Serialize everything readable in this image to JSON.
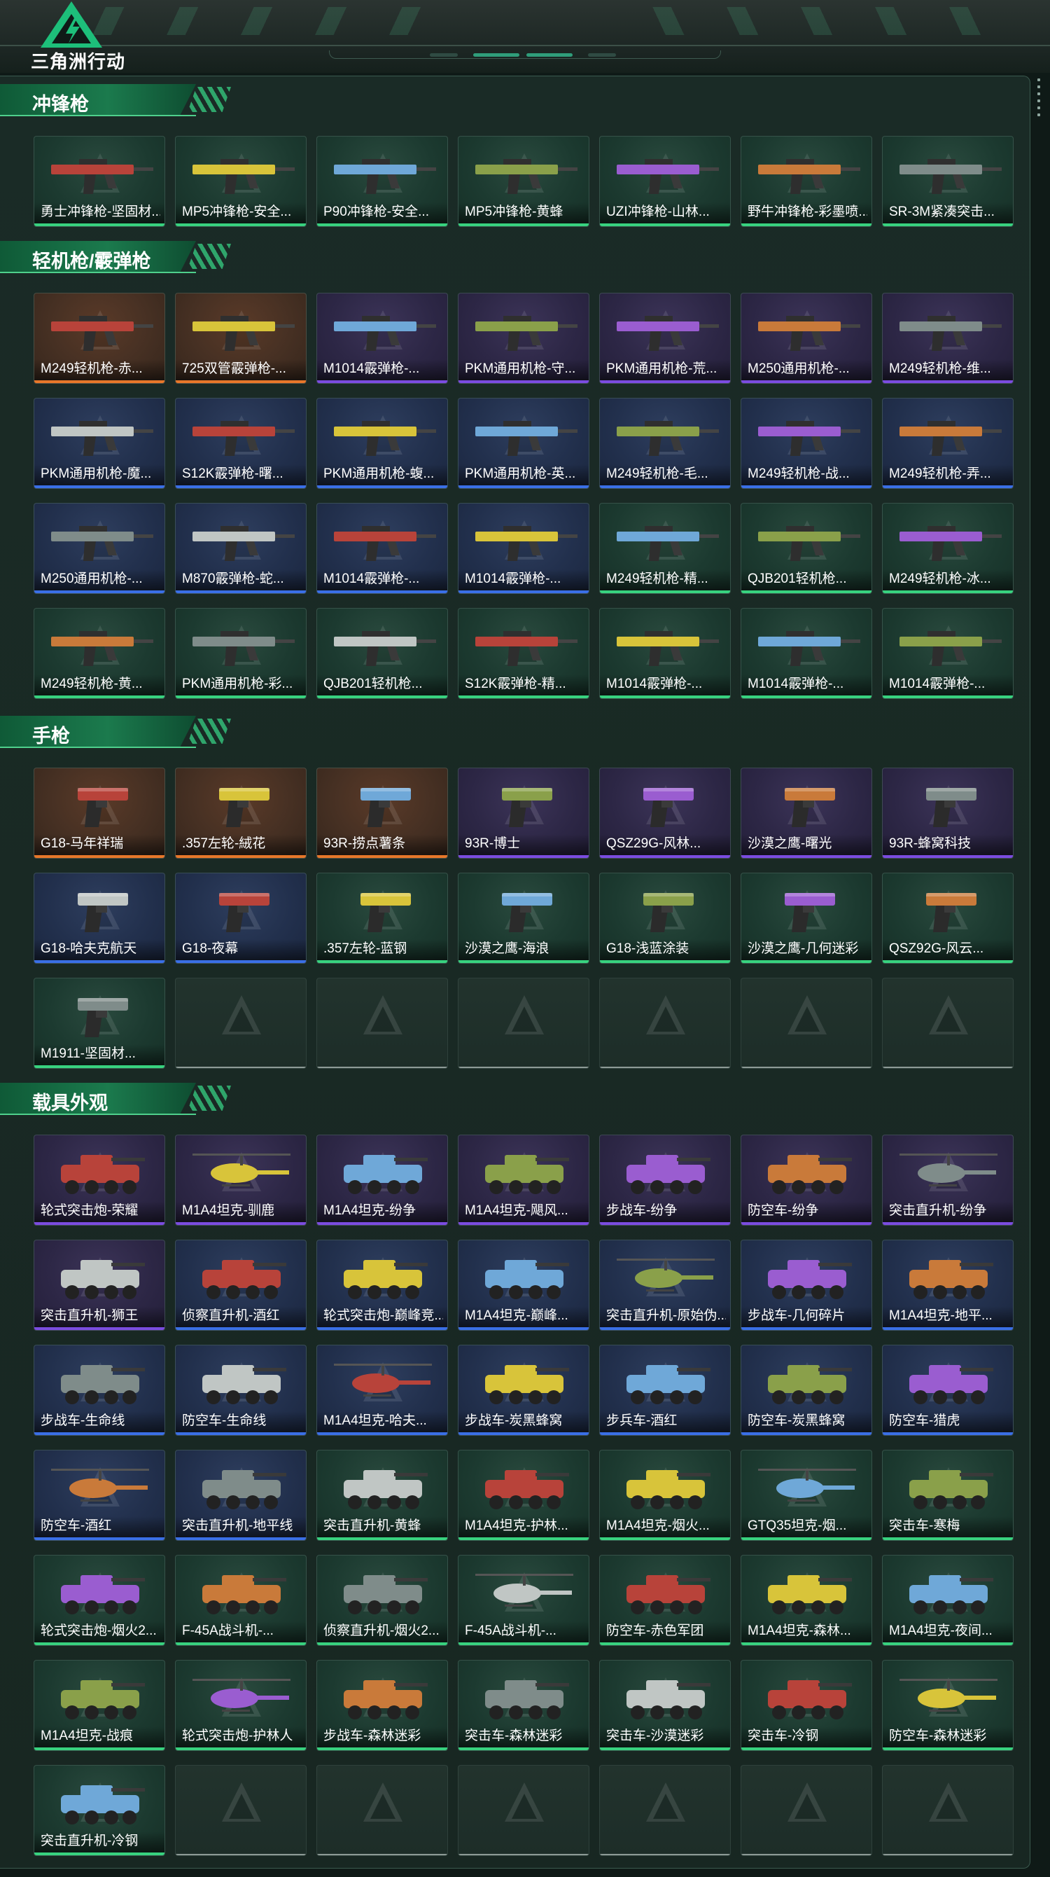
{
  "header": {
    "logo_text": "三角洲行动"
  },
  "colors": {
    "green": "#38d27f",
    "purple": "#7b4ce0",
    "blue": "#3a6fe6",
    "orange": "#e7772a"
  },
  "sections": [
    {
      "title": "冲锋枪",
      "icon": "gun-icon",
      "items": [
        {
          "name": "勇士冲锋枪-坚固材...",
          "rarity": "green"
        },
        {
          "name": "MP5冲锋枪-安全...",
          "rarity": "green"
        },
        {
          "name": "P90冲锋枪-安全...",
          "rarity": "green"
        },
        {
          "name": "MP5冲锋枪-黄蜂",
          "rarity": "green"
        },
        {
          "name": "UZI冲锋枪-山林...",
          "rarity": "green"
        },
        {
          "name": "野牛冲锋枪-彩墨喷...",
          "rarity": "green"
        },
        {
          "name": "SR-3M紧凑突击...",
          "rarity": "green"
        }
      ]
    },
    {
      "title": "轻机枪/霰弹枪",
      "icon": "gun-icon",
      "items": [
        {
          "name": "M249轻机枪-赤...",
          "rarity": "orange"
        },
        {
          "name": "725双管霰弹枪-...",
          "rarity": "orange"
        },
        {
          "name": "M1014霰弹枪-...",
          "rarity": "purple"
        },
        {
          "name": "PKM通用机枪-守...",
          "rarity": "purple"
        },
        {
          "name": "PKM通用机枪-荒...",
          "rarity": "purple"
        },
        {
          "name": "M250通用机枪-...",
          "rarity": "purple"
        },
        {
          "name": "M249轻机枪-维...",
          "rarity": "purple"
        },
        {
          "name": "PKM通用机枪-魔...",
          "rarity": "blue"
        },
        {
          "name": "S12K霰弹枪-曙...",
          "rarity": "blue"
        },
        {
          "name": "PKM通用机枪-蝮...",
          "rarity": "blue"
        },
        {
          "name": "PKM通用机枪-英...",
          "rarity": "blue"
        },
        {
          "name": "M249轻机枪-毛...",
          "rarity": "blue"
        },
        {
          "name": "M249轻机枪-战...",
          "rarity": "blue"
        },
        {
          "name": "M249轻机枪-弄...",
          "rarity": "blue"
        },
        {
          "name": "M250通用机枪-...",
          "rarity": "blue"
        },
        {
          "name": "M870霰弹枪-蛇...",
          "rarity": "blue"
        },
        {
          "name": "M1014霰弹枪-...",
          "rarity": "blue"
        },
        {
          "name": "M1014霰弹枪-...",
          "rarity": "blue"
        },
        {
          "name": "M249轻机枪-精...",
          "rarity": "green"
        },
        {
          "name": "QJB201轻机枪...",
          "rarity": "green"
        },
        {
          "name": "M249轻机枪-冰...",
          "rarity": "green"
        },
        {
          "name": "M249轻机枪-黄...",
          "rarity": "green"
        },
        {
          "name": "PKM通用机枪-彩...",
          "rarity": "green"
        },
        {
          "name": "QJB201轻机枪...",
          "rarity": "green"
        },
        {
          "name": "S12K霰弹枪-精...",
          "rarity": "green"
        },
        {
          "name": "M1014霰弹枪-...",
          "rarity": "green"
        },
        {
          "name": "M1014霰弹枪-...",
          "rarity": "green"
        },
        {
          "name": "M1014霰弹枪-...",
          "rarity": "green"
        }
      ]
    },
    {
      "title": "手枪",
      "icon": "pistol-icon",
      "items": [
        {
          "name": "G18-马年祥瑞",
          "rarity": "orange"
        },
        {
          "name": ".357左轮-絨花",
          "rarity": "orange"
        },
        {
          "name": "93R-捞点薯条",
          "rarity": "orange"
        },
        {
          "name": "93R-博士",
          "rarity": "purple"
        },
        {
          "name": "QSZ29G-风林...",
          "rarity": "purple"
        },
        {
          "name": "沙漠之鹰-曙光",
          "rarity": "purple"
        },
        {
          "name": "93R-蜂窝科技",
          "rarity": "purple"
        },
        {
          "name": "G18-哈夫克航天",
          "rarity": "blue"
        },
        {
          "name": "G18-夜幕",
          "rarity": "blue"
        },
        {
          "name": ".357左轮-蓝钢",
          "rarity": "green"
        },
        {
          "name": "沙漠之鹰-海浪",
          "rarity": "green"
        },
        {
          "name": "G18-浅蓝涂装",
          "rarity": "green"
        },
        {
          "name": "沙漠之鹰-几何迷彩",
          "rarity": "green"
        },
        {
          "name": "QSZ92G-风云...",
          "rarity": "green"
        },
        {
          "name": "M1911-坚固材...",
          "rarity": "green"
        },
        {
          "name": "",
          "rarity": "empty"
        },
        {
          "name": "",
          "rarity": "empty"
        },
        {
          "name": "",
          "rarity": "empty"
        },
        {
          "name": "",
          "rarity": "empty"
        },
        {
          "name": "",
          "rarity": "empty"
        },
        {
          "name": "",
          "rarity": "empty"
        }
      ]
    },
    {
      "title": "载具外观",
      "icon": "vehicle-icon",
      "items": [
        {
          "name": "轮式突击炮-荣耀",
          "rarity": "purple"
        },
        {
          "name": "M1A4坦克-驯鹿",
          "rarity": "purple"
        },
        {
          "name": "M1A4坦克-纷争",
          "rarity": "purple"
        },
        {
          "name": "M1A4坦克-飓风...",
          "rarity": "purple"
        },
        {
          "name": "步战车-纷争",
          "rarity": "purple"
        },
        {
          "name": "防空车-纷争",
          "rarity": "purple"
        },
        {
          "name": "突击直升机-纷争",
          "rarity": "purple"
        },
        {
          "name": "突击直升机-狮王",
          "rarity": "purple"
        },
        {
          "name": "侦察直升机-酒红",
          "rarity": "blue"
        },
        {
          "name": "轮式突击炮-巅峰竞...",
          "rarity": "blue"
        },
        {
          "name": "M1A4坦克-巅峰...",
          "rarity": "blue"
        },
        {
          "name": "突击直升机-原始伪...",
          "rarity": "blue"
        },
        {
          "name": "步战车-几何碎片",
          "rarity": "blue"
        },
        {
          "name": "M1A4坦克-地平...",
          "rarity": "blue"
        },
        {
          "name": "步战车-生命线",
          "rarity": "blue"
        },
        {
          "name": "防空车-生命线",
          "rarity": "blue"
        },
        {
          "name": "M1A4坦克-哈夫...",
          "rarity": "blue"
        },
        {
          "name": "步战车-炭黑蜂窝",
          "rarity": "blue"
        },
        {
          "name": "步兵车-酒红",
          "rarity": "blue"
        },
        {
          "name": "防空车-炭黑蜂窝",
          "rarity": "blue"
        },
        {
          "name": "防空车-猎虎",
          "rarity": "blue"
        },
        {
          "name": "防空车-酒红",
          "rarity": "blue"
        },
        {
          "name": "突击直升机-地平线",
          "rarity": "blue"
        },
        {
          "name": "突击直升机-黄蜂",
          "rarity": "green"
        },
        {
          "name": "M1A4坦克-护林...",
          "rarity": "green"
        },
        {
          "name": "M1A4坦克-烟火...",
          "rarity": "green"
        },
        {
          "name": "GTQ35坦克-烟...",
          "rarity": "green"
        },
        {
          "name": "突击车-寒梅",
          "rarity": "green"
        },
        {
          "name": "轮式突击炮-烟火2...",
          "rarity": "green"
        },
        {
          "name": "F-45A战斗机-...",
          "rarity": "green"
        },
        {
          "name": "侦察直升机-烟火2...",
          "rarity": "green"
        },
        {
          "name": "F-45A战斗机-...",
          "rarity": "green"
        },
        {
          "name": "防空车-赤色军团",
          "rarity": "green"
        },
        {
          "name": "M1A4坦克-森林...",
          "rarity": "green"
        },
        {
          "name": "M1A4坦克-夜间...",
          "rarity": "green"
        },
        {
          "name": "M1A4坦克-战痕",
          "rarity": "green"
        },
        {
          "name": "轮式突击炮-护林人",
          "rarity": "green"
        },
        {
          "name": "步战车-森林迷彩",
          "rarity": "green"
        },
        {
          "name": "突击车-森林迷彩",
          "rarity": "green"
        },
        {
          "name": "突击车-沙漠迷彩",
          "rarity": "green"
        },
        {
          "name": "突击车-冷钢",
          "rarity": "green"
        },
        {
          "name": "防空车-森林迷彩",
          "rarity": "green"
        },
        {
          "name": "突击直升机-冷钢",
          "rarity": "green"
        },
        {
          "name": "",
          "rarity": "empty"
        },
        {
          "name": "",
          "rarity": "empty"
        },
        {
          "name": "",
          "rarity": "empty"
        },
        {
          "name": "",
          "rarity": "empty"
        },
        {
          "name": "",
          "rarity": "empty"
        },
        {
          "name": "",
          "rarity": "empty"
        }
      ]
    }
  ]
}
